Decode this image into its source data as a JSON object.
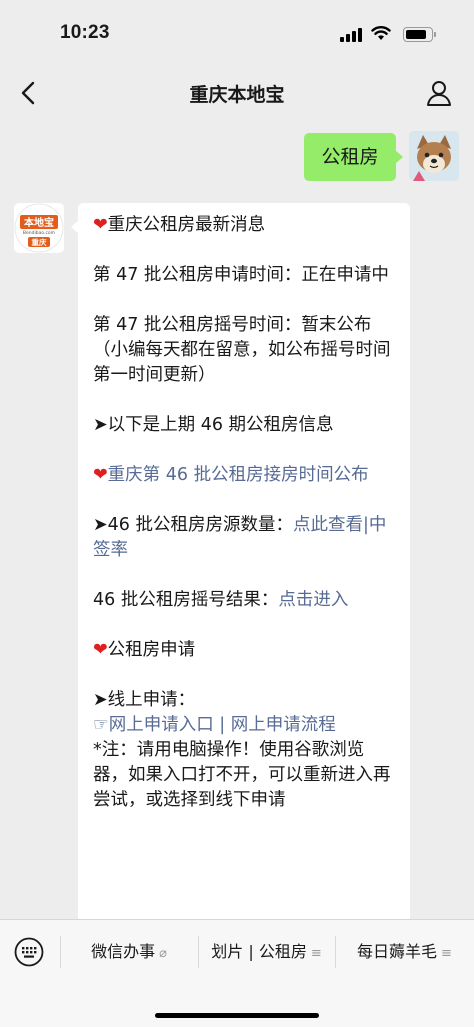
{
  "status": {
    "time": "10:23"
  },
  "nav": {
    "title": "重庆本地宝",
    "back_icon": "chevron-left-icon",
    "user_icon": "person-icon"
  },
  "my_message": {
    "text": "公租房"
  },
  "bot_avatar": {
    "logo_text": "本地宝",
    "logo_sub": "Bendibao.com",
    "city": "重庆"
  },
  "reply": {
    "p1": "重庆公租房最新消息",
    "p2": "第 47 批公租房申请时间：正在申请中",
    "p3": "第 47 批公租房摇号时间：暂末公布（小编每天都在留意，如公布摇号时间第一时间更新）",
    "p4": "➤以下是上期 46 期公租房信息",
    "p5_link": "重庆第 46 批公租房接房时间公布",
    "p6_text": "➤46 批公租房房源数量：",
    "p6_link1": "点此查看",
    "p6_sep": "|",
    "p6_link2": "中签率",
    "p7_text": "46 批公租房摇号结果：",
    "p7_link": "点击进入",
    "p8": "公租房申请",
    "p9_text": "➤线上申请：",
    "p9_hand": "☞",
    "p9_link1": "网上申请入口",
    "p9_sep": " | ",
    "p9_link2": "网上申请流程",
    "p9_note": "*注：请用电脑操作！使用谷歌浏览器，如果入口打不开，可以重新进入再尝试，或选择到线下申请"
  },
  "bottom_menu": {
    "keyboard_icon": "keyboard-icon",
    "item1": "微信办事",
    "item2": "划片 | 公租房",
    "item3": "每日薅羊毛",
    "tag_link": "⌀",
    "tag_menu": "≡"
  }
}
